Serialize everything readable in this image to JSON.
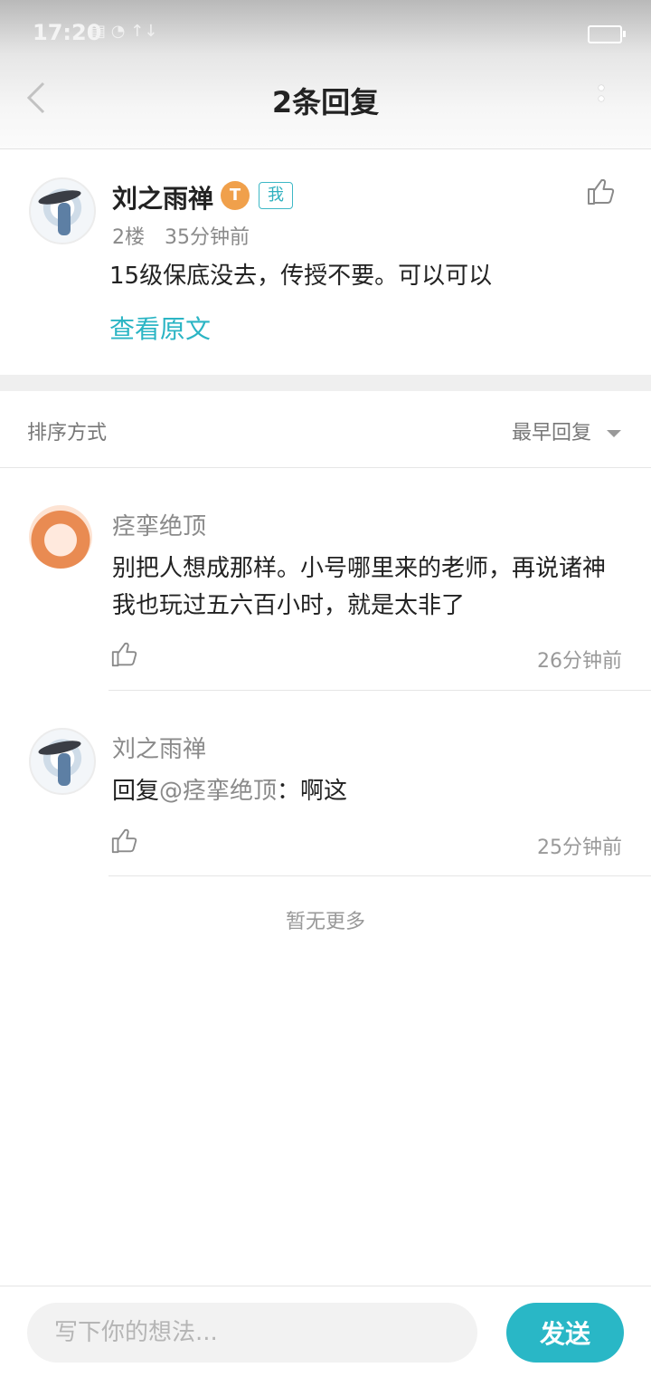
{
  "status_bar": {
    "time": "17:20",
    "icons": "▤ ◔ ↑↓"
  },
  "header": {
    "title": "2条回复"
  },
  "post": {
    "author": "刘之雨禅",
    "level": "T",
    "me_label": "我",
    "floor": "2楼",
    "time": "35分钟前",
    "content": "15级保底没去，传授不要。可以可以",
    "view_original": "查看原文"
  },
  "sort": {
    "label": "排序方式",
    "value": "最早回复"
  },
  "replies": [
    {
      "author": "痉挛绝顶",
      "text": "别把人想成那样。小号哪里来的老师，再说诸神我也玩过五六百小时，就是太非了",
      "time": "26分钟前"
    },
    {
      "author": "刘之雨禅",
      "reply_prefix": "回复",
      "mention": "@痉挛绝顶",
      "text": "：啊这",
      "time": "25分钟前"
    }
  ],
  "list_end": "暂无更多",
  "composer": {
    "placeholder": "写下你的想法...",
    "send_label": "发送"
  },
  "colors": {
    "accent": "#29b7c6",
    "level_badge": "#f0a04b"
  },
  "icons": [
    "back-arrow-icon",
    "more-icon",
    "thumbs-up-icon",
    "caret-down-icon"
  ]
}
